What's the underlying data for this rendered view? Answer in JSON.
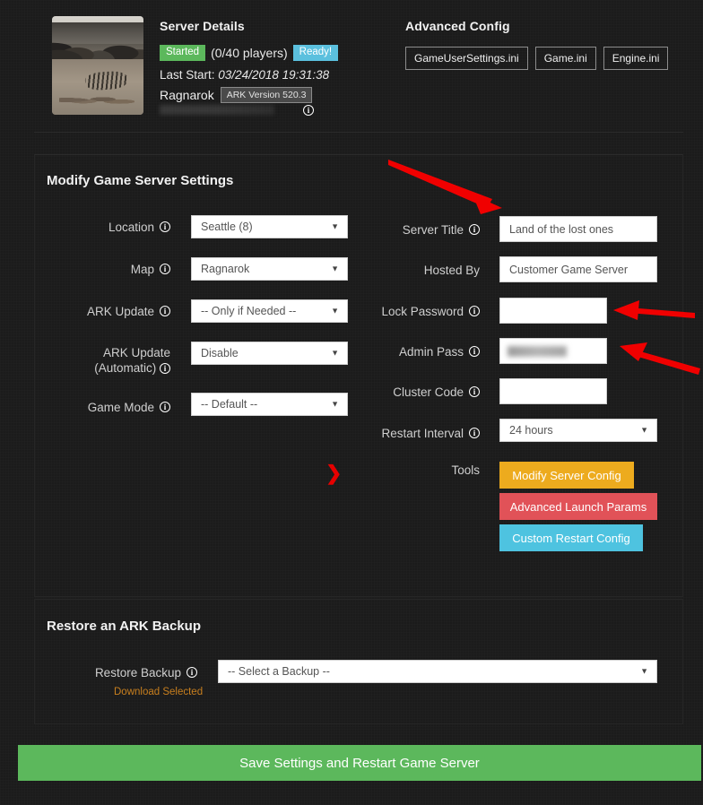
{
  "server_details": {
    "heading": "Server Details",
    "status_badge": "Started",
    "players": "(0/40 players)",
    "ready_badge": "Ready!",
    "last_start_label": "Last Start:",
    "last_start_value": "03/24/2018 19:31:38",
    "map_name": "Ragnarok",
    "version_badge": "ARK Version 520.3",
    "info_icon": "info-icon",
    "thumbnail_alt": "ark-server-map-thumbnail"
  },
  "advanced_config": {
    "heading": "Advanced Config",
    "buttons": [
      "GameUserSettings.ini",
      "Game.ini",
      "Engine.ini"
    ]
  },
  "modify_settings": {
    "heading": "Modify Game Server Settings",
    "left_fields": [
      {
        "label": "Location",
        "value": "Seattle (8)",
        "type": "select",
        "info": true
      },
      {
        "label": "Map",
        "value": "Ragnarok",
        "type": "select",
        "info": true
      },
      {
        "label": "ARK Update",
        "value": "-- Only if Needed --",
        "type": "select",
        "info": true
      },
      {
        "label": "ARK Update",
        "label2": "(Automatic)",
        "value": "Disable",
        "type": "select",
        "info": true
      },
      {
        "label": "Game Mode",
        "value": "-- Default --",
        "type": "select",
        "info": true
      }
    ],
    "right_fields": [
      {
        "label": "Server Title",
        "value": "Land of the lost ones",
        "type": "text",
        "info": true
      },
      {
        "label": "Hosted By",
        "value": "Customer Game Server",
        "type": "text",
        "info": false
      },
      {
        "label": "Lock Password",
        "value": "",
        "type": "password",
        "info": true
      },
      {
        "label": "Admin Pass",
        "value": "",
        "type": "password",
        "info": true,
        "masked": true
      },
      {
        "label": "Cluster Code",
        "value": "",
        "type": "text",
        "info": true
      },
      {
        "label": "Restart Interval",
        "value": "24 hours",
        "type": "select",
        "info": true
      }
    ],
    "tools_label": "Tools",
    "tools": [
      {
        "label": "Modify Server Config",
        "color": "#edab1e"
      },
      {
        "label": "Advanced Launch Params",
        "color": "#e15258"
      },
      {
        "label": "Custom Restart Config",
        "color": "#4ec3e0"
      }
    ]
  },
  "restore_backup": {
    "heading": "Restore an ARK Backup",
    "field_label": "Restore Backup",
    "select_value": "-- Select a Backup --",
    "download_link": "Download Selected"
  },
  "footer": {
    "save_label": "Save Settings and Restart Game Server",
    "save_color": "#5cb85c"
  },
  "annotations": {
    "arrow_color": "#f00000",
    "chevron_glyph": "❯",
    "arrows": [
      {
        "name": "arrow-to-server-title",
        "points_at": "Server Title"
      },
      {
        "name": "arrow-to-lock-password",
        "points_at": "Lock Password"
      },
      {
        "name": "arrow-to-admin-pass",
        "points_at": "Admin Pass"
      }
    ]
  }
}
